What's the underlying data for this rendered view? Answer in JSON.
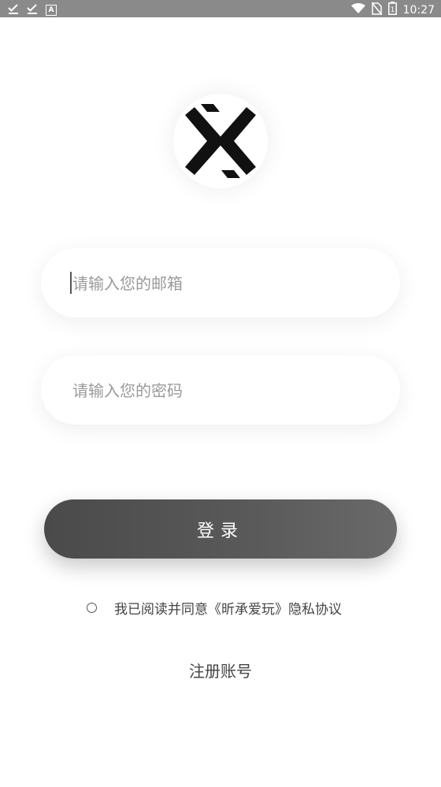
{
  "status_bar": {
    "time": "10:27",
    "battery_level": "1",
    "left_icons": [
      "check-download-icon",
      "check-download-icon",
      "a-box-icon"
    ],
    "right_icons": [
      "wifi-icon",
      "no-sim-icon",
      "battery-icon"
    ]
  },
  "logo": {
    "icon": "x-logo-icon"
  },
  "email": {
    "placeholder": "请输入您的邮箱",
    "value": ""
  },
  "password": {
    "placeholder": "请输入您的密码",
    "value": ""
  },
  "login": {
    "label": "登录"
  },
  "agreement": {
    "checked": false,
    "text": "我已阅读并同意《昕承爱玩》隐私协议"
  },
  "register": {
    "label": "注册账号"
  }
}
